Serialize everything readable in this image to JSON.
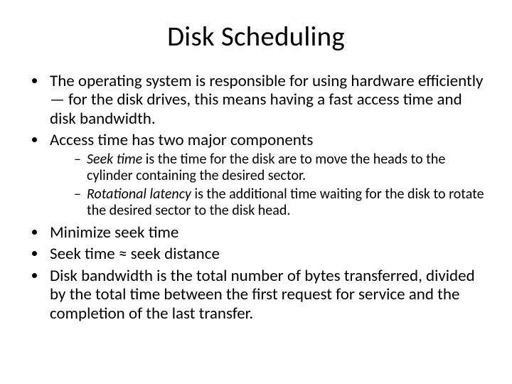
{
  "title": "Disk Scheduling",
  "b1": "The operating system is responsible for using hardware efficiently — for the disk drives, this means having a fast access time and disk bandwidth.",
  "b2": "Access time has two major components",
  "b2s1_it": "Seek time",
  "b2s1_rest": " is the time for the disk are to move the heads to the cylinder containing the desired sector.",
  "b2s2_it": "Rotational latency",
  "b2s2_rest": " is the additional time waiting for the disk to rotate the desired sector to the disk head.",
  "b3": "Minimize seek time",
  "b4": "Seek time ≈ seek distance",
  "b5": "Disk bandwidth is the total number of bytes transferred, divided by the total time between the first request for service and the completion of the last transfer."
}
